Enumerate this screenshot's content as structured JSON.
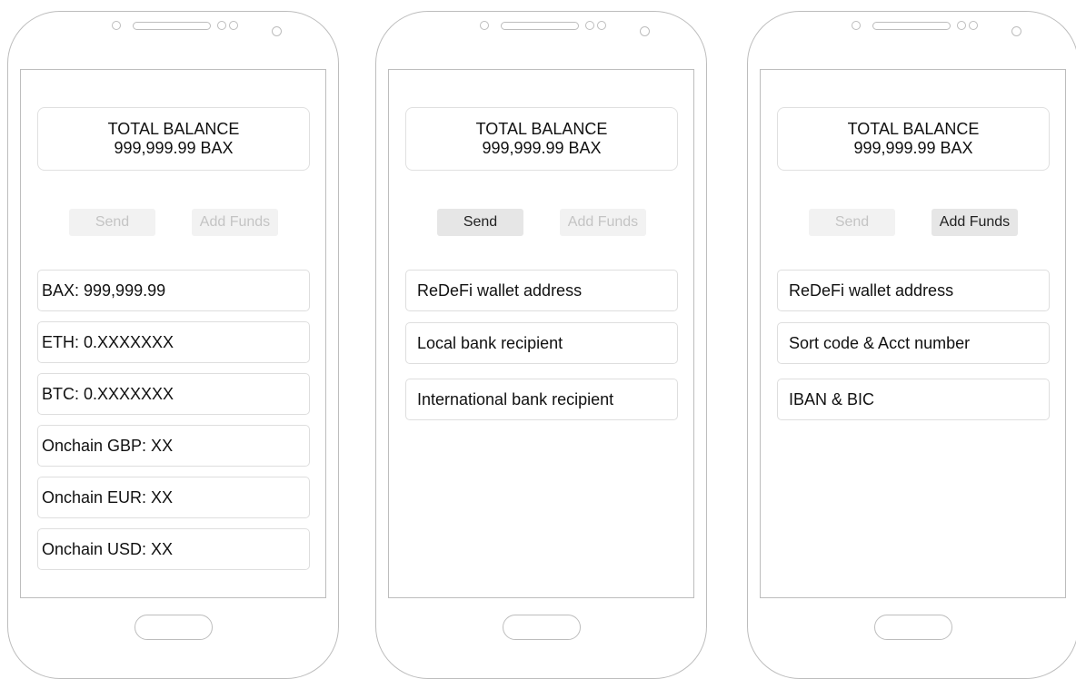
{
  "screens": [
    {
      "balance": {
        "title": "TOTAL BALANCE",
        "amount": "999,999.99 BAX"
      },
      "tabs": {
        "send_label": "Send",
        "add_funds_label": "Add Funds",
        "active": "none"
      },
      "items": [
        {
          "label": "BAX: 999,999.99"
        },
        {
          "label": "ETH: 0.XXXXXXX"
        },
        {
          "label": "BTC: 0.XXXXXXX"
        },
        {
          "label": "Onchain GBP: XX"
        },
        {
          "label": "Onchain EUR: XX"
        },
        {
          "label": "Onchain USD: XX"
        }
      ]
    },
    {
      "balance": {
        "title": "TOTAL BALANCE",
        "amount": "999,999.99 BAX"
      },
      "tabs": {
        "send_label": "Send",
        "add_funds_label": "Add Funds",
        "active": "send"
      },
      "items": [
        {
          "label": "ReDeFi wallet address"
        },
        {
          "label": "Local bank recipient"
        },
        {
          "label": "International bank recipient"
        }
      ]
    },
    {
      "balance": {
        "title": "TOTAL BALANCE",
        "amount": "999,999.99 BAX"
      },
      "tabs": {
        "send_label": "Send",
        "add_funds_label": "Add Funds",
        "active": "add_funds"
      },
      "items": [
        {
          "label": "ReDeFi wallet address"
        },
        {
          "label": "Sort code & Acct number"
        },
        {
          "label": "IBAN & BIC"
        }
      ]
    }
  ],
  "colors": {
    "frame": "#bdbdbd",
    "active_tab_bg": "#e6e6e6",
    "inactive_tab_bg": "#f2f2f2",
    "inactive_text": "#c4c4c4"
  },
  "icons": {
    "camera": "camera-icon",
    "sensor": "sensor-icon",
    "speaker": "speaker-grille-icon",
    "home": "home-button"
  }
}
